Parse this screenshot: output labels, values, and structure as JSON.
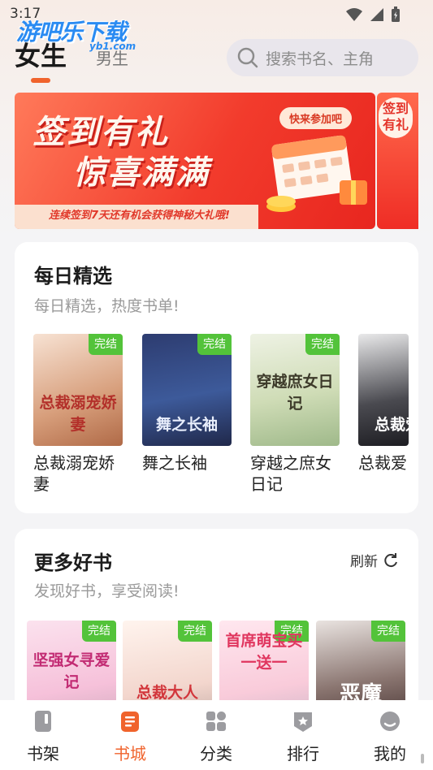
{
  "status": {
    "time": "3:17"
  },
  "watermark": {
    "title": "游吧乐下载",
    "domain": "yb1.com"
  },
  "header": {
    "tabs": [
      {
        "label": "女生",
        "active": true
      },
      {
        "label": "男生",
        "active": false
      }
    ],
    "search_placeholder": "搜索书名、主角"
  },
  "banner": {
    "line1": "签到有礼",
    "line2": "惊喜满满",
    "pill": "快来参加吧",
    "subtitle": "连续签到7天还有机会获得神秘大礼哦!",
    "side_label_1": "签到",
    "side_label_2": "有礼"
  },
  "daily": {
    "title": "每日精选",
    "subtitle": "每日精选，热度书单!",
    "badge": "完结",
    "books": [
      {
        "name": "总裁溺宠娇妻",
        "cover_title": "总裁溺宠娇妻"
      },
      {
        "name": "舞之长袖",
        "cover_title": "舞之长袖"
      },
      {
        "name": "穿越之庶女日记",
        "cover_title": "穿越庶女日记"
      },
      {
        "name": "总裁爱",
        "cover_title": "总裁爱"
      }
    ]
  },
  "more": {
    "title": "更多好书",
    "subtitle": "发现好书，享受阅读!",
    "refresh": "刷新",
    "books": [
      {
        "cover_title": "坚强女寻爱记"
      },
      {
        "cover_title": "总裁大人"
      },
      {
        "cover_title": "首席萌宝买一送一"
      },
      {
        "cover_title": "恶魔"
      }
    ]
  },
  "nav": [
    {
      "label": "书架",
      "icon": "bookshelf-icon"
    },
    {
      "label": "书城",
      "icon": "bookstore-icon",
      "active": true
    },
    {
      "label": "分类",
      "icon": "category-icon"
    },
    {
      "label": "排行",
      "icon": "ranking-icon"
    },
    {
      "label": "我的",
      "icon": "profile-icon"
    }
  ],
  "colors": {
    "accent": "#f0632c",
    "complete_badge": "#53c33a",
    "banner_red": "#f23b2c"
  }
}
